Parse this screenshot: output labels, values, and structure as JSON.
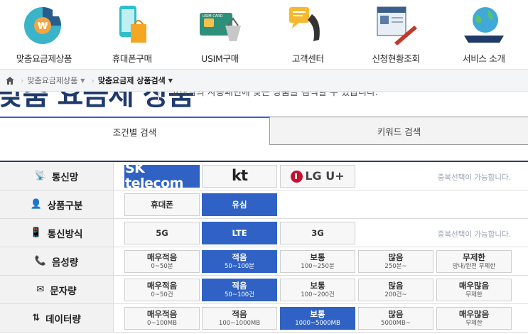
{
  "nav": [
    {
      "label": "맞춤요금제상품",
      "icon": "coin-phone-icon"
    },
    {
      "label": "휴대폰구매",
      "icon": "phone-bag-icon"
    },
    {
      "label": "USIM구매",
      "icon": "usim-card-icon"
    },
    {
      "label": "고객센터",
      "icon": "call-center-icon"
    },
    {
      "label": "신청현황조회",
      "icon": "document-pen-icon"
    },
    {
      "label": "서비스 소개",
      "icon": "globe-tablet-icon"
    }
  ],
  "breadcrumb": {
    "home_icon": "home-icon",
    "items": [
      "맞춤요금제상품",
      "맞춤요금제 상품검색"
    ]
  },
  "page_heading": {
    "title": "맞춤 요금제 상품",
    "subtitle": "고객님의 사용패턴에 맞는 상품을 검색할 수 있습니다."
  },
  "tabs": {
    "conditional": "조건별 검색",
    "keyword": "키워드 검색"
  },
  "filters": {
    "carrier": {
      "label": "통신망",
      "icon": "antenna-icon",
      "options": [
        "SK telecom",
        "kt",
        "LG U+"
      ],
      "note": "중복선택이 가능합니다."
    },
    "product": {
      "label": "상품구분",
      "icon": "person-icon",
      "options": [
        "휴대폰",
        "유심"
      ],
      "selected": "유심"
    },
    "method": {
      "label": "통신방식",
      "icon": "smartphone-icon",
      "options": [
        "5G",
        "LTE",
        "3G"
      ],
      "selected": "LTE",
      "note": "중복선택이 가능합니다."
    },
    "voice": {
      "label": "음성량",
      "icon": "phone-handset-icon",
      "options": [
        {
          "label": "매우적음",
          "sub": "0~50분"
        },
        {
          "label": "적음",
          "sub": "50~100분"
        },
        {
          "label": "보통",
          "sub": "100~250분"
        },
        {
          "label": "많음",
          "sub": "250분~"
        },
        {
          "label": "무제한",
          "sub": "망내/완전 무제한"
        }
      ],
      "selected": "적음"
    },
    "sms": {
      "label": "문자량",
      "icon": "envelope-icon",
      "options": [
        {
          "label": "매우적음",
          "sub": "0~50건"
        },
        {
          "label": "적음",
          "sub": "50~100건"
        },
        {
          "label": "보통",
          "sub": "100~200건"
        },
        {
          "label": "많음",
          "sub": "200건~"
        },
        {
          "label": "매우많음",
          "sub": "무제한"
        }
      ],
      "selected": "적음"
    },
    "data": {
      "label": "데이터량",
      "icon": "updown-arrows-icon",
      "options": [
        {
          "label": "매우적음",
          "sub": "0~100MB"
        },
        {
          "label": "적음",
          "sub": "100~1000MB"
        },
        {
          "label": "보통",
          "sub": "1000~5000MB"
        },
        {
          "label": "많음",
          "sub": "5000MB~"
        },
        {
          "label": "매우많음",
          "sub": "무제한"
        }
      ],
      "selected": "보통"
    }
  },
  "colors": {
    "accent": "#2f62c4",
    "header_dark": "#2e3c58"
  }
}
